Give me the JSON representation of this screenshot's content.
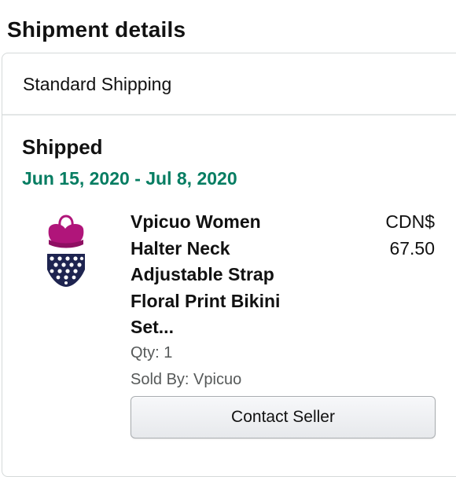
{
  "header": {
    "title": "Shipment details"
  },
  "shipment": {
    "method": "Standard Shipping",
    "status": "Shipped",
    "delivery_range": "Jun 15, 2020 - Jul 8, 2020"
  },
  "item": {
    "title_lines": [
      "Vpicuo Women",
      "Halter Neck",
      "Adjustable Strap",
      "Floral Print Bikini",
      "Set..."
    ],
    "price_lines": [
      "CDN$",
      "67.50"
    ],
    "quantity": "Qty: 1",
    "sold_by": "Sold By: Vpicuo",
    "thumbnail_icon": "bikini-thumbnail"
  },
  "actions": {
    "contact_seller_label": "Contact Seller"
  },
  "colors": {
    "delivery_date": "#067d62",
    "top_color": "#b0157a",
    "bottom_color": "#1e2450"
  }
}
